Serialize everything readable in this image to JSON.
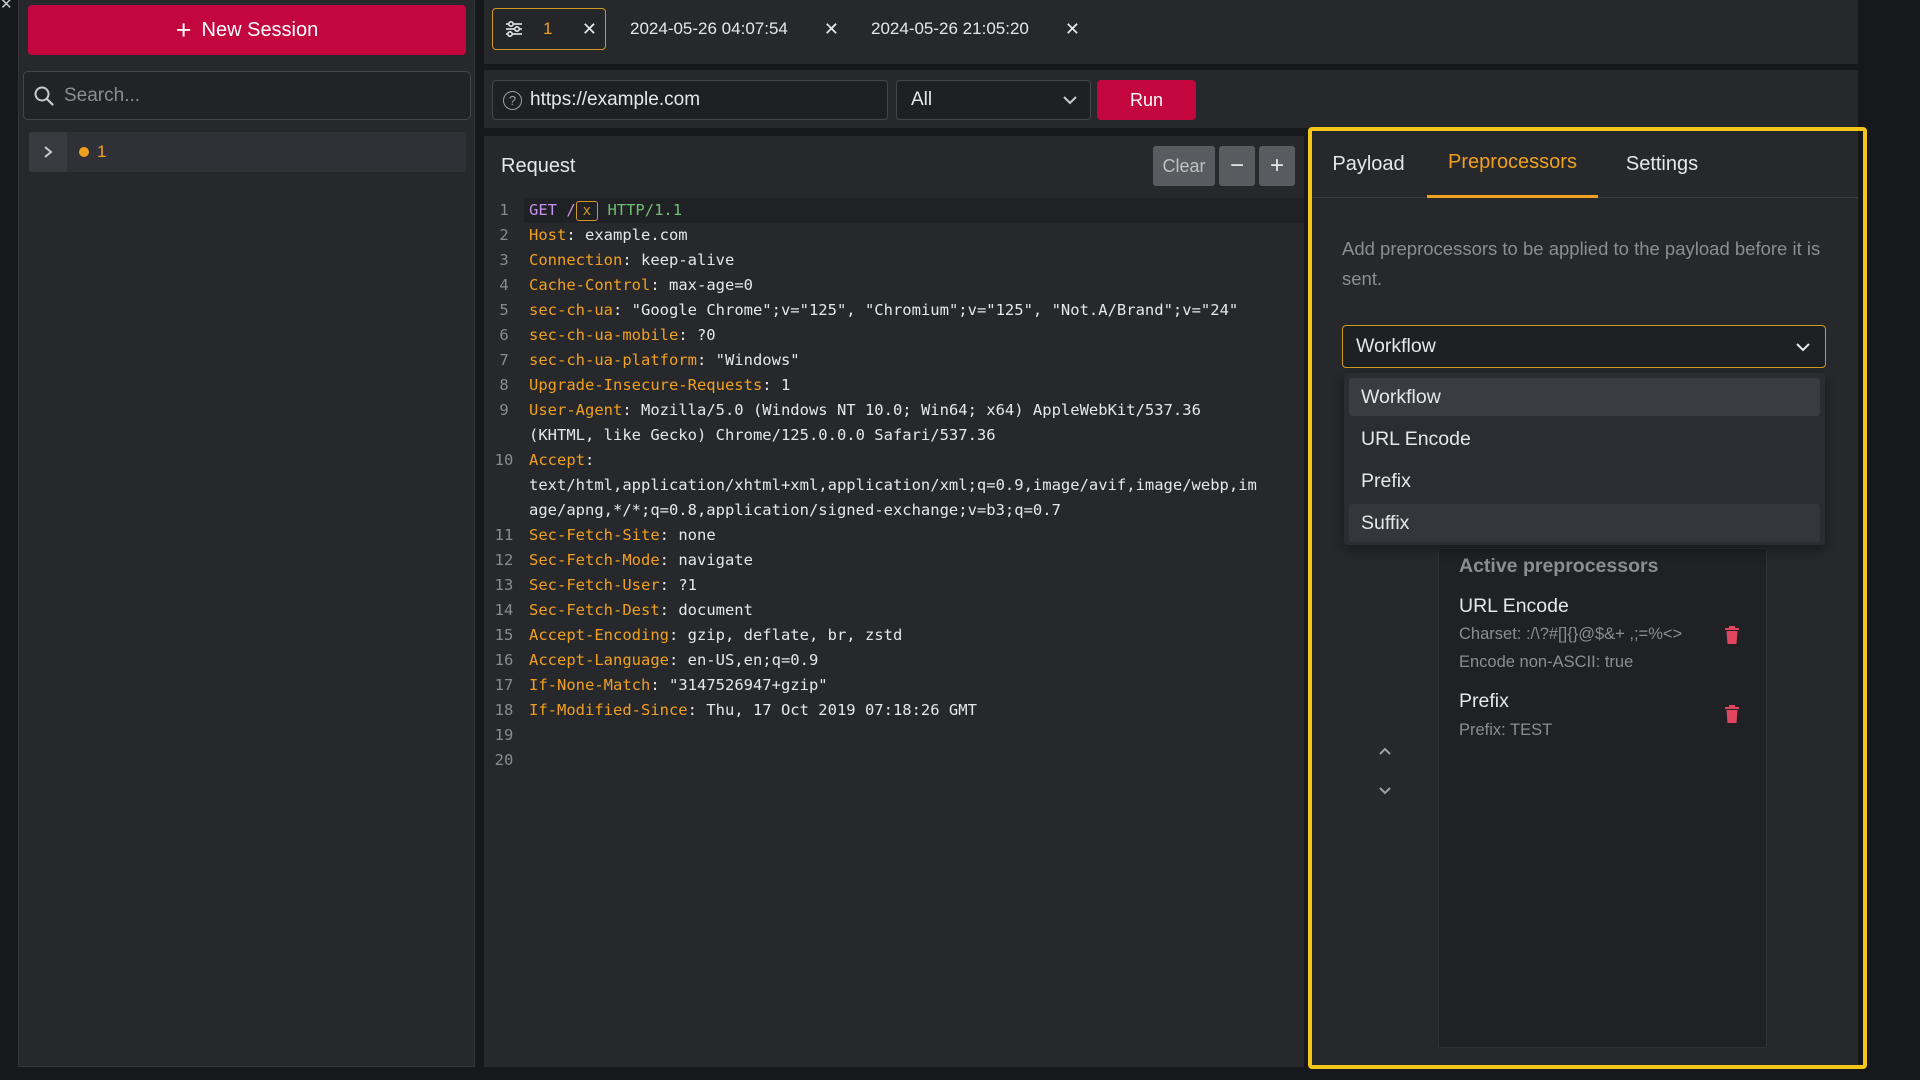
{
  "sidebar": {
    "new_session_label": "New Session",
    "search_placeholder": "Search...",
    "tree_item_label": "1"
  },
  "tabs": {
    "active_number": "1",
    "tab2_label": "2024-05-26 04:07:54",
    "tab3_label": "2024-05-26 21:05:20",
    "close_glyph": "✕"
  },
  "urlbar": {
    "url_value": "https://example.com",
    "method_selected": "All",
    "run_label": "Run"
  },
  "request": {
    "title": "Request",
    "clear_label": "Clear",
    "minus_label": "−",
    "plus_label": "+",
    "lines": [
      {
        "n": "1",
        "key": "GET /",
        "val": "",
        "marker": "x",
        "ver": " HTTP/1.1"
      },
      {
        "n": "2",
        "key": "Host",
        "val": ": example.com"
      },
      {
        "n": "3",
        "key": "Connection",
        "val": ": keep-alive"
      },
      {
        "n": "4",
        "key": "Cache-Control",
        "val": ": max-age=0"
      },
      {
        "n": "5",
        "key": "sec-ch-ua",
        "val": ": \"Google Chrome\";v=\"125\", \"Chromium\";v=\"125\", \"Not.A/Brand\";v=\"24\""
      },
      {
        "n": "6",
        "key": "sec-ch-ua-mobile",
        "val": ": ?0"
      },
      {
        "n": "7",
        "key": "sec-ch-ua-platform",
        "val": ": \"Windows\""
      },
      {
        "n": "8",
        "key": "Upgrade-Insecure-Requests",
        "val": ": 1"
      },
      {
        "n": "9",
        "key": "User-Agent",
        "val": ": Mozilla/5.0 (Windows NT 10.0; Win64; x64) AppleWebKit/537.36",
        "cont": [
          "(KHTML, like Gecko) Chrome/125.0.0.0 Safari/537.36"
        ]
      },
      {
        "n": "10",
        "key": "Accept",
        "val": ":",
        "cont": [
          "text/html,application/xhtml+xml,application/xml;q=0.9,image/avif,image/webp,im",
          "age/apng,*/*;q=0.8,application/signed-exchange;v=b3;q=0.7"
        ]
      },
      {
        "n": "11",
        "key": "Sec-Fetch-Site",
        "val": ": none"
      },
      {
        "n": "12",
        "key": "Sec-Fetch-Mode",
        "val": ": navigate"
      },
      {
        "n": "13",
        "key": "Sec-Fetch-User",
        "val": ": ?1"
      },
      {
        "n": "14",
        "key": "Sec-Fetch-Dest",
        "val": ": document"
      },
      {
        "n": "15",
        "key": "Accept-Encoding",
        "val": ": gzip, deflate, br, zstd"
      },
      {
        "n": "16",
        "key": "Accept-Language",
        "val": ": en-US,en;q=0.9"
      },
      {
        "n": "17",
        "key": "If-None-Match",
        "val": ": \"3147526947+gzip\""
      },
      {
        "n": "18",
        "key": "If-Modified-Since",
        "val": ": Thu, 17 Oct 2019 07:18:26 GMT"
      },
      {
        "n": "19",
        "key": "",
        "val": ""
      },
      {
        "n": "20",
        "key": "",
        "val": ""
      }
    ]
  },
  "right_panel": {
    "tab_payload": "Payload",
    "tab_preprocessors": "Preprocessors",
    "tab_settings": "Settings",
    "hint": "Add preprocessors to be applied to the payload before it is sent.",
    "select_value": "Workflow",
    "options": [
      "Workflow",
      "URL Encode",
      "Prefix",
      "Suffix"
    ],
    "active_title": "Active preprocessors",
    "active": [
      {
        "name": "URL Encode",
        "details": [
          "Charset: :/\\?#[]{}@$&+ ,;=%<>",
          "Encode non-ASCII: true"
        ]
      },
      {
        "name": "Prefix",
        "details": [
          "Prefix: TEST"
        ]
      }
    ]
  },
  "colors": {
    "accent": "#f0a020",
    "brand_red": "#c4063f",
    "highlight": "#f5c518",
    "delete_red": "#e0465e"
  }
}
